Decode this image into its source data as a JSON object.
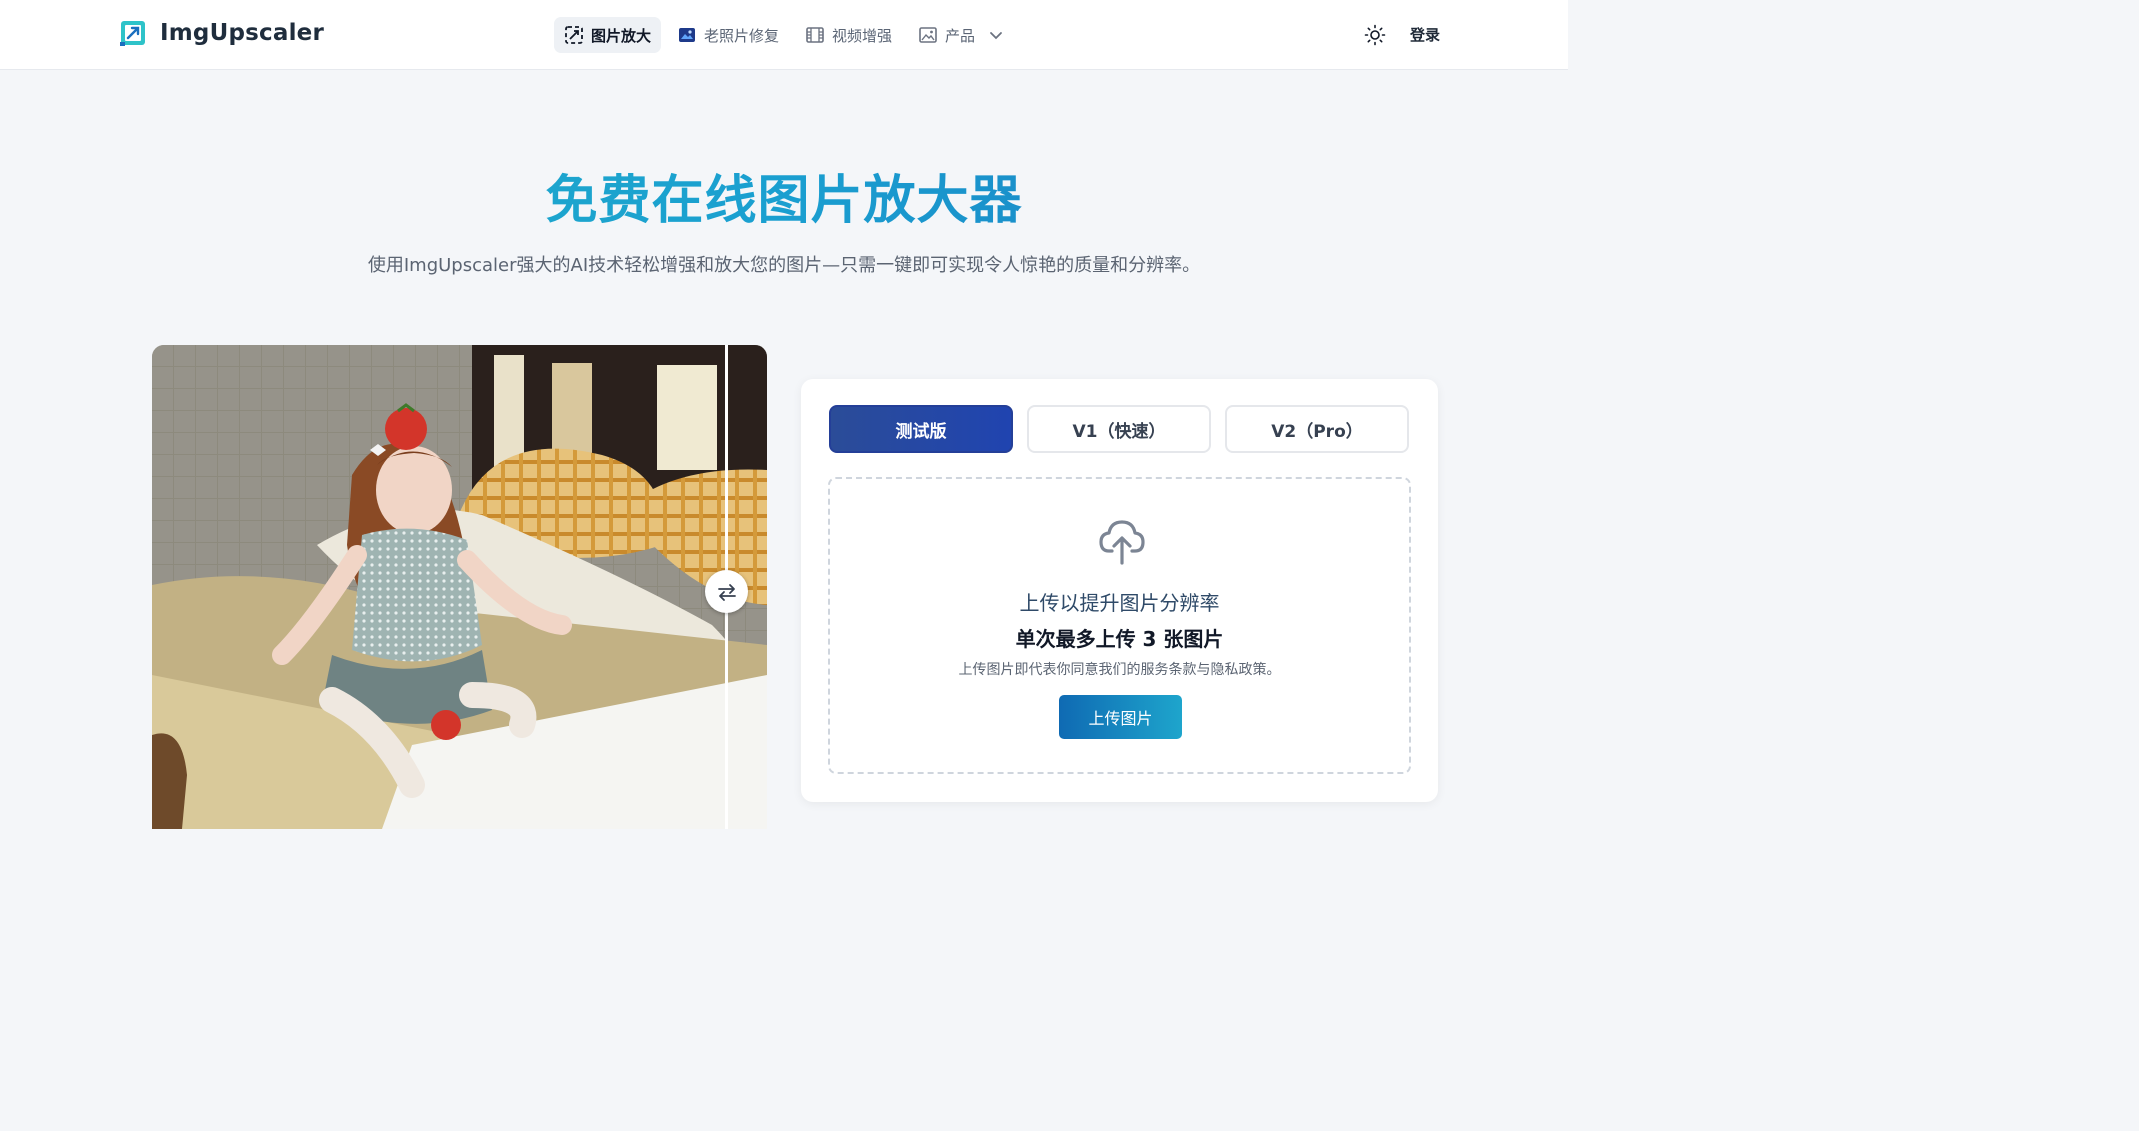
{
  "header": {
    "brand": "ImgUpscaler",
    "nav": [
      {
        "label": "图片放大",
        "icon": "upscale-icon",
        "active": true
      },
      {
        "label": "老照片修复",
        "icon": "photo-restore-icon",
        "active": false
      },
      {
        "label": "视频增强",
        "icon": "film-icon",
        "active": false
      },
      {
        "label": "产品",
        "icon": "image-icon",
        "active": false,
        "dropdown": true
      }
    ],
    "theme_icon": "sun-icon",
    "login_label": "登录"
  },
  "hero": {
    "title": "免费在线图片放大器",
    "subtitle": "使用ImgUpscaler强大的AI技术轻松增强和放大您的图片—只需一键即可实现令人惊艳的质量和分辨率。"
  },
  "compare": {
    "swap_icon": "swap-arrows-icon"
  },
  "upload": {
    "tabs": [
      {
        "label": "测试版",
        "active": true
      },
      {
        "label": "V1（快速）",
        "active": false
      },
      {
        "label": "V2（Pro）",
        "active": false
      }
    ],
    "title": "上传以提升图片分辨率",
    "limit": "单次最多上传 3 张图片",
    "terms": "上传图片即代表你同意我们的服务条款与隐私政策。",
    "button": "上传图片",
    "icon": "cloud-upload-icon"
  },
  "colors": {
    "accent_gradient_start": "#22b2c9",
    "accent_gradient_end": "#1b6fbf",
    "tab_active": "#2b4c98",
    "button": "#1579bd"
  }
}
